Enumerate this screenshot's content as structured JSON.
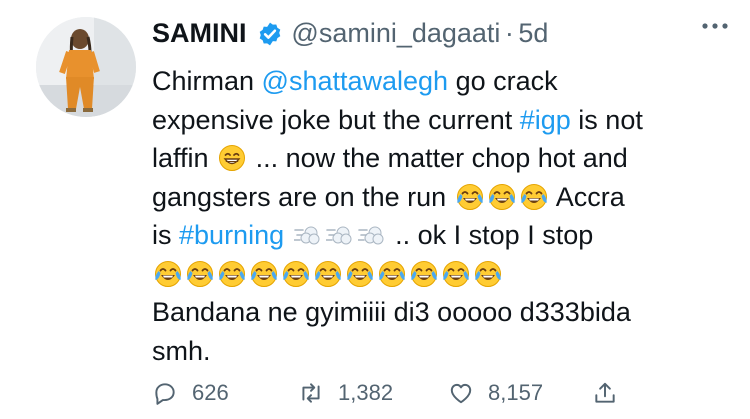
{
  "author": {
    "name": "SAMINI",
    "handle": "@samini_dagaati",
    "separator": "·",
    "time": "5d",
    "verified": true
  },
  "tweet": {
    "line1_a": "Chirman",
    "mention": "@shattawalegh",
    "line1_b": "go crack",
    "line2_a": "expensive joke but the current",
    "hashtag1": "#igp",
    "line2_b": "is not",
    "line3_a": "laffin",
    "line3_b": "... now the matter chop hot and",
    "line4_a": "gangsters are on the run",
    "line4_b": "Accra",
    "line5_a": "is",
    "hashtag2": "#burning",
    "line5_b": ".. ok I stop I stop",
    "line7": "Bandana ne gyimiiii di3 ooooo d333bida",
    "line8": "smh.",
    "emojis": {
      "grin": "grinning-face-with-smiling-eyes",
      "joy": "face-with-tears-of-joy",
      "dash": "dashing-away",
      "joy_row_count": 11
    }
  },
  "actions": {
    "replies": "626",
    "retweets": "1,382",
    "likes": "8,157"
  },
  "colors": {
    "link": "#1d9bf0",
    "verified": "#1d9bf0",
    "text": "#0f1419",
    "secondary": "#536471"
  }
}
